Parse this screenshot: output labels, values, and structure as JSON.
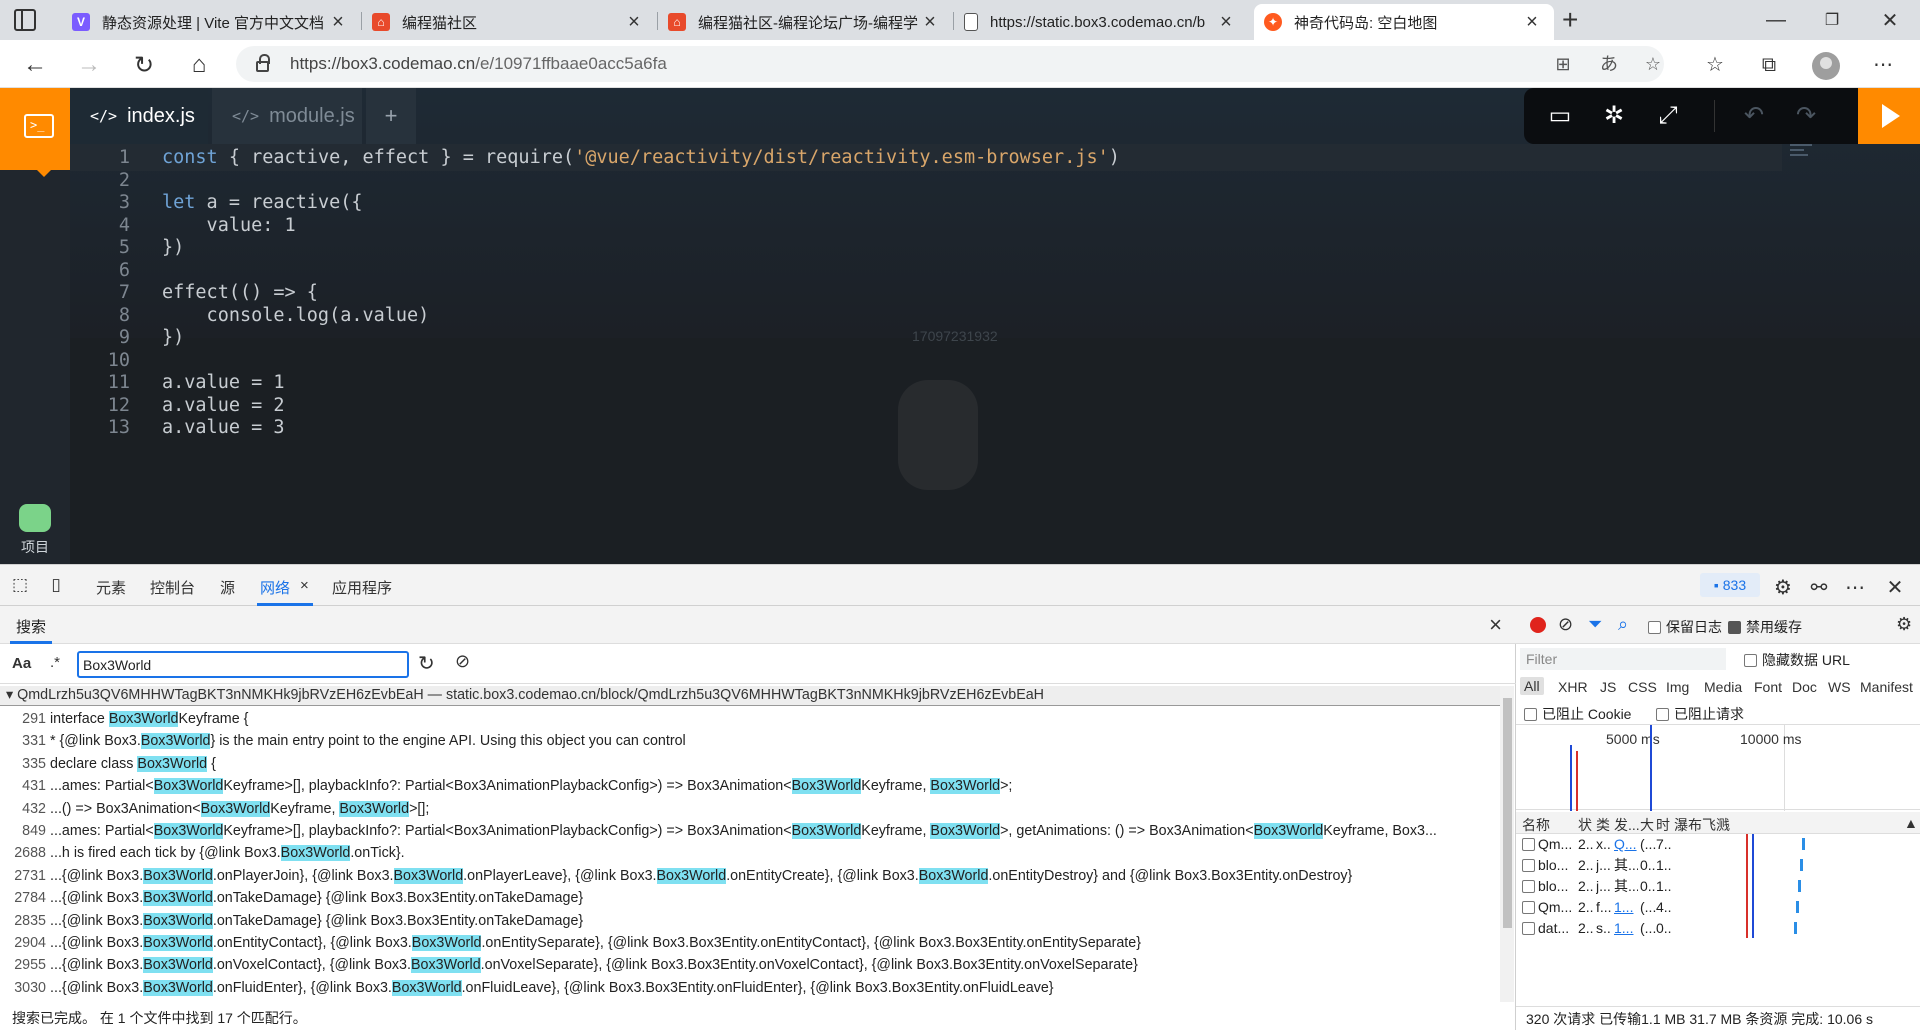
{
  "browser": {
    "tabs": [
      {
        "title": "静态资源处理 | Vite 官方中文文档",
        "icon": "vite-icon",
        "color": "#7b5cff"
      },
      {
        "title": "编程猫社区",
        "icon": "codemao-icon",
        "color": "#e84a2b"
      },
      {
        "title": "编程猫社区-编程论坛广场-编程学",
        "icon": "codemao-icon",
        "color": "#e84a2b"
      },
      {
        "title": "https://static.box3.codemao.cn/b",
        "icon": "page-icon",
        "color": "#555555"
      },
      {
        "title": "神奇代码岛: 空白地图",
        "icon": "box3-icon",
        "color": "#ff5a1f"
      }
    ],
    "url_host": "https://box3.codemao.cn",
    "url_path": "/e/10971ffbaae0acc5a6fa"
  },
  "editor": {
    "tabs": [
      "index.js",
      "module.js"
    ],
    "add_tab": "+",
    "project_label": "项目",
    "watermark": "17097231932",
    "lines": [
      {
        "n": "1",
        "parts": [
          {
            "t": "const",
            "k": "kw"
          },
          {
            "t": " { reactive, effect } = require(",
            "k": ""
          },
          {
            "t": "'@vue/reactivity/dist/reactivity.esm-browser.js'",
            "k": "str"
          },
          {
            "t": ")",
            "k": ""
          }
        ]
      },
      {
        "n": "2",
        "parts": []
      },
      {
        "n": "3",
        "parts": [
          {
            "t": "let",
            "k": "kw"
          },
          {
            "t": " a = reactive({",
            "k": ""
          }
        ]
      },
      {
        "n": "4",
        "parts": [
          {
            "t": "    value: 1",
            "k": ""
          }
        ]
      },
      {
        "n": "5",
        "parts": [
          {
            "t": "})",
            "k": ""
          }
        ]
      },
      {
        "n": "6",
        "parts": []
      },
      {
        "n": "7",
        "parts": [
          {
            "t": "effect(() => {",
            "k": ""
          }
        ]
      },
      {
        "n": "8",
        "parts": [
          {
            "t": "    console.log(a.value)",
            "k": ""
          }
        ]
      },
      {
        "n": "9",
        "parts": [
          {
            "t": "})",
            "k": ""
          }
        ]
      },
      {
        "n": "10",
        "parts": []
      },
      {
        "n": "11",
        "parts": [
          {
            "t": "a.value = 1",
            "k": ""
          }
        ]
      },
      {
        "n": "12",
        "parts": [
          {
            "t": "a.value = 2",
            "k": ""
          }
        ]
      },
      {
        "n": "13",
        "parts": [
          {
            "t": "a.value = 3",
            "k": ""
          }
        ]
      }
    ],
    "accent": "#ff8a00"
  },
  "devtools": {
    "tabs": [
      "元素",
      "控制台",
      "源",
      "网络",
      "应用程序"
    ],
    "selected_tab": "网络",
    "issues_count": "833",
    "search": {
      "title": "搜索",
      "case_label": "Aa",
      "regex_label": ".*",
      "query": "Box3World",
      "file": "QmdLrzh5u3QV6MHHWTagBKT3nNMKHk9jbRVzEH6zEvbEaH — static.box3.codemao.cn/block/QmdLrzh5u3QV6MHHWTagBKT3nNMKHk9jbRVzEH6zEvbEaH",
      "results": [
        {
          "n": "291",
          "text": "interface Box3WorldKeyframe {"
        },
        {
          "n": "331",
          "text": "* {@link Box3.Box3World} is the main entry point to the engine API.  Using this object you can control"
        },
        {
          "n": "335",
          "text": "declare class Box3World {"
        },
        {
          "n": "431",
          "text": "...ames: Partial<Box3WorldKeyframe>[], playbackInfo?: Partial<Box3AnimationPlaybackConfig>) => Box3Animation<Box3WorldKeyframe, Box3World>;"
        },
        {
          "n": "432",
          "text": "...() => Box3Animation<Box3WorldKeyframe, Box3World>[];"
        },
        {
          "n": "849",
          "text": "...ames: Partial<Box3WorldKeyframe>[], playbackInfo?: Partial<Box3AnimationPlaybackConfig>) => Box3Animation<Box3WorldKeyframe, Box3World>, getAnimations: () => Box3Animation<Box3WorldKeyframe, Box3..."
        },
        {
          "n": "2688",
          "text": "...h is fired each tick by {@link Box3.Box3World.onTick}."
        },
        {
          "n": "2731",
          "text": "...{@link Box3.Box3World.onPlayerJoin}, {@link Box3.Box3World.onPlayerLeave}, {@link Box3.Box3World.onEntityCreate}, {@link Box3.Box3World.onEntityDestroy} and {@link Box3.Box3Entity.onDestroy}"
        },
        {
          "n": "2784",
          "text": "...{@link Box3.Box3World.onTakeDamage} {@link Box3.Box3Entity.onTakeDamage}"
        },
        {
          "n": "2835",
          "text": "...{@link Box3.Box3World.onTakeDamage} {@link Box3.Box3Entity.onTakeDamage}"
        },
        {
          "n": "2904",
          "text": "...{@link Box3.Box3World.onEntityContact}, {@link Box3.Box3World.onEntitySeparate}, {@link Box3.Box3Entity.onEntityContact}, {@link Box3.Box3Entity.onEntitySeparate}"
        },
        {
          "n": "2955",
          "text": "...{@link Box3.Box3World.onVoxelContact}, {@link Box3.Box3World.onVoxelSeparate}, {@link Box3.Box3Entity.onVoxelContact}, {@link Box3.Box3Entity.onVoxelSeparate}"
        },
        {
          "n": "3030",
          "text": "...{@link Box3.Box3World.onFluidEnter}, {@link Box3.Box3World.onFluidLeave}, {@link Box3.Box3Entity.onFluidEnter}, {@link Box3.Box3Entity.onFluidLeave}"
        }
      ],
      "status": "搜索已完成。  在 1 个文件中找到 17 个匹配行。"
    },
    "network": {
      "preserve_log": "保留日志",
      "disable_cache": "禁用缓存",
      "filter_placeholder": "Filter",
      "hide_data_urls": "隐藏数据 URL",
      "types": [
        "All",
        "XHR",
        "JS",
        "CSS",
        "Img",
        "Media",
        "Font",
        "Doc",
        "WS",
        "Manifest"
      ],
      "blocked_cookies": "已阻止 Cookie",
      "blocked_requests": "已阻止请求",
      "timeline_labels": [
        "5000 ms",
        "10000 ms"
      ],
      "columns": [
        "名称",
        "状",
        "类",
        "发...",
        "大",
        "时",
        "瀑布飞溅"
      ],
      "rows": [
        {
          "name": "Qm...",
          "s": "2...",
          "t": "x...",
          "i": "Q...",
          "z": "(...",
          "m": "7..."
        },
        {
          "name": "blo...",
          "s": "2...",
          "t": "j...",
          "i": "其...",
          "z": "0...",
          "m": "1..."
        },
        {
          "name": "blo...",
          "s": "2...",
          "t": "j...",
          "i": "其...",
          "z": "0...",
          "m": "1..."
        },
        {
          "name": "Qm...",
          "s": "2...",
          "t": "f...",
          "i": "1...",
          "z": "(...",
          "m": "4..."
        },
        {
          "name": "dat...",
          "s": "2...",
          "t": "s...",
          "i": "1...",
          "z": "(...",
          "m": "0..."
        }
      ],
      "status": "320 次请求  已传输1.1 MB  31.7 MB 条资源  完成: 10.06 s"
    }
  }
}
